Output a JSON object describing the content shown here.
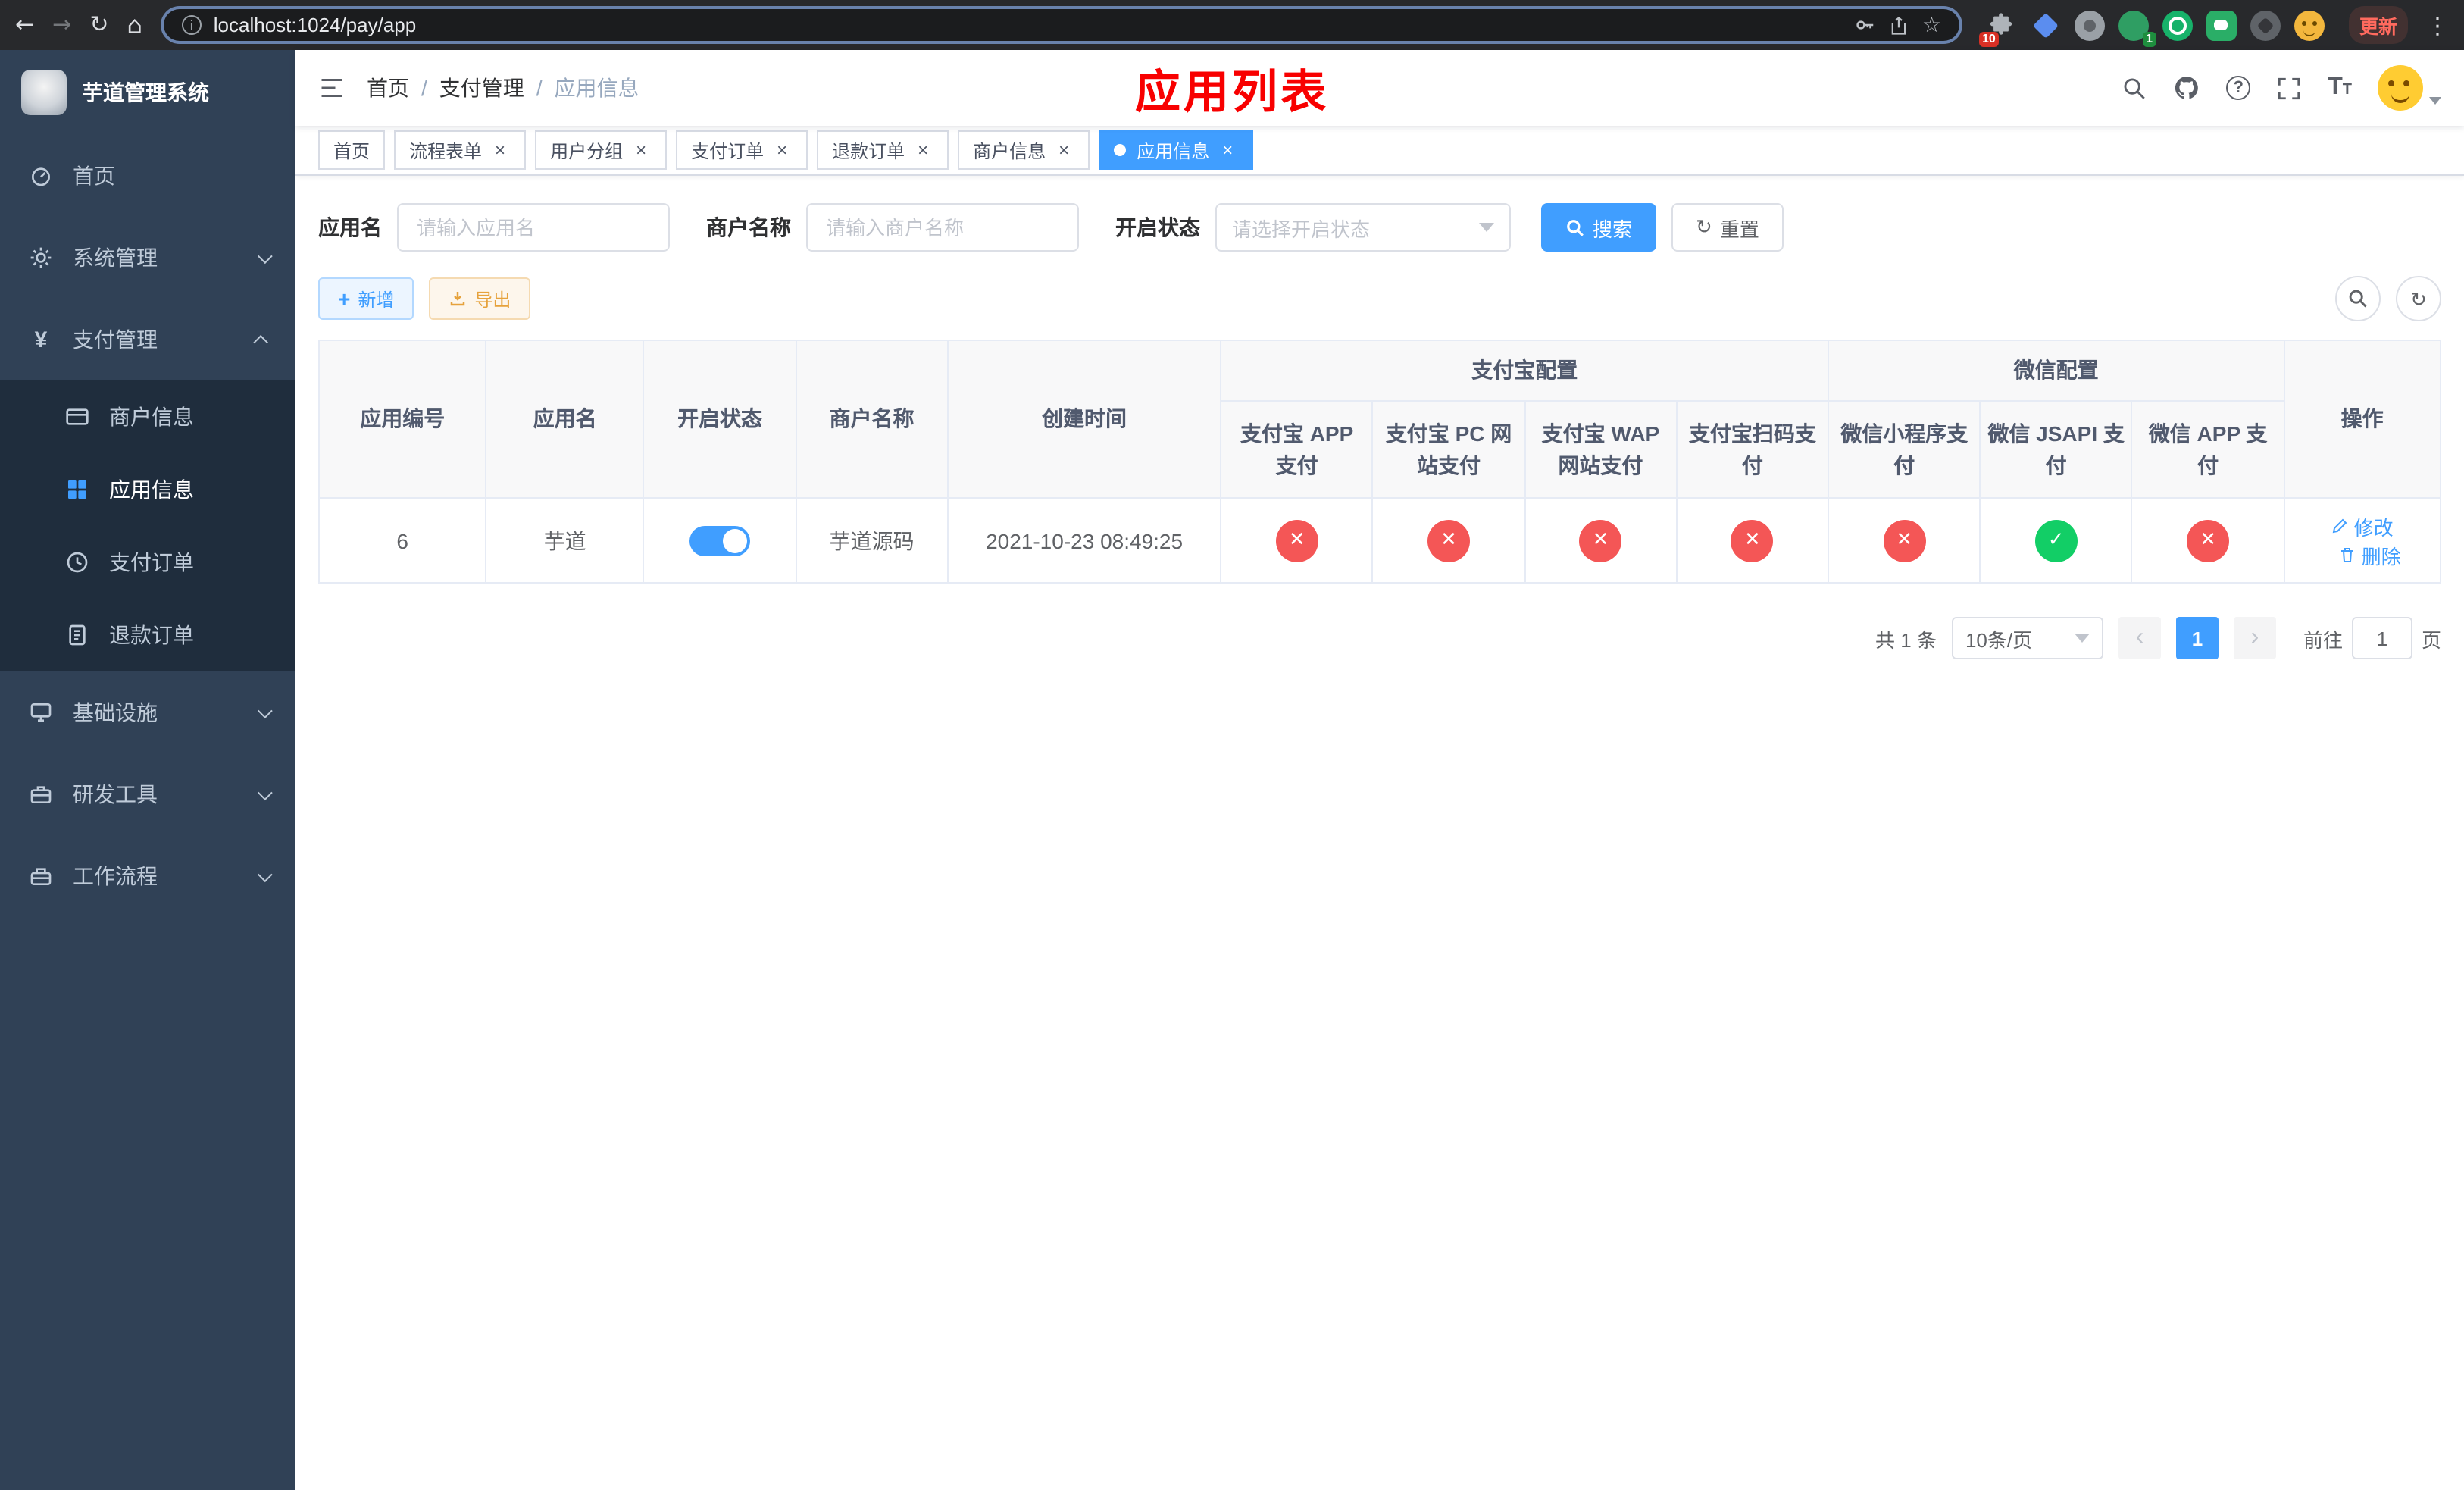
{
  "browser": {
    "url": "localhost:1024/pay/app",
    "update_label": "更新",
    "extensions_badge": "10",
    "profile_badge": "1"
  },
  "sidebar": {
    "app_title": "芋道管理系统",
    "menu": [
      {
        "label": "首页"
      },
      {
        "label": "系统管理"
      },
      {
        "label": "支付管理"
      },
      {
        "label": "基础设施"
      },
      {
        "label": "研发工具"
      },
      {
        "label": "工作流程"
      }
    ],
    "pay_children": [
      {
        "label": "商户信息"
      },
      {
        "label": "应用信息"
      },
      {
        "label": "支付订单"
      },
      {
        "label": "退款订单"
      }
    ]
  },
  "navbar": {
    "breadcrumb": [
      "首页",
      "支付管理",
      "应用信息"
    ],
    "title": "应用列表"
  },
  "tabs": [
    {
      "label": "首页"
    },
    {
      "label": "流程表单"
    },
    {
      "label": "用户分组"
    },
    {
      "label": "支付订单"
    },
    {
      "label": "退款订单"
    },
    {
      "label": "商户信息"
    },
    {
      "label": "应用信息"
    }
  ],
  "filter": {
    "app_name_label": "应用名",
    "app_name_placeholder": "请输入应用名",
    "merchant_label": "商户名称",
    "merchant_placeholder": "请输入商户名称",
    "status_label": "开启状态",
    "status_placeholder": "请选择开启状态",
    "search_label": "搜索",
    "reset_label": "重置"
  },
  "toolbar": {
    "add_label": "新增",
    "export_label": "导出"
  },
  "table": {
    "headers": {
      "left": [
        "应用编号",
        "应用名",
        "开启状态",
        "商户名称",
        "创建时间"
      ],
      "alipay_group": "支付宝配置",
      "alipay": [
        "支付宝 APP 支付",
        "支付宝 PC 网站支付",
        "支付宝 WAP 网站支付",
        "支付宝扫码支付"
      ],
      "wechat_group": "微信配置",
      "wechat": [
        "微信小程序支付",
        "微信 JSAPI 支付",
        "微信 APP 支付"
      ],
      "action": "操作"
    },
    "rows": [
      {
        "app_id": "6",
        "app_name": "芋道",
        "enabled": true,
        "merchant_name": "芋道源码",
        "create_time": "2021-10-23 08:49:25",
        "channels": [
          false,
          false,
          false,
          false,
          false,
          true,
          false
        ],
        "edit_label": "修改",
        "delete_label": "删除"
      }
    ]
  },
  "pagination": {
    "total_text": "共 1 条",
    "page_size_text": "10条/页",
    "current_page": "1",
    "goto_label": "前往",
    "goto_value": "1",
    "goto_suffix": "页"
  },
  "icons": {
    "enabled_glyph": "✓",
    "disabled_glyph": "✕"
  }
}
